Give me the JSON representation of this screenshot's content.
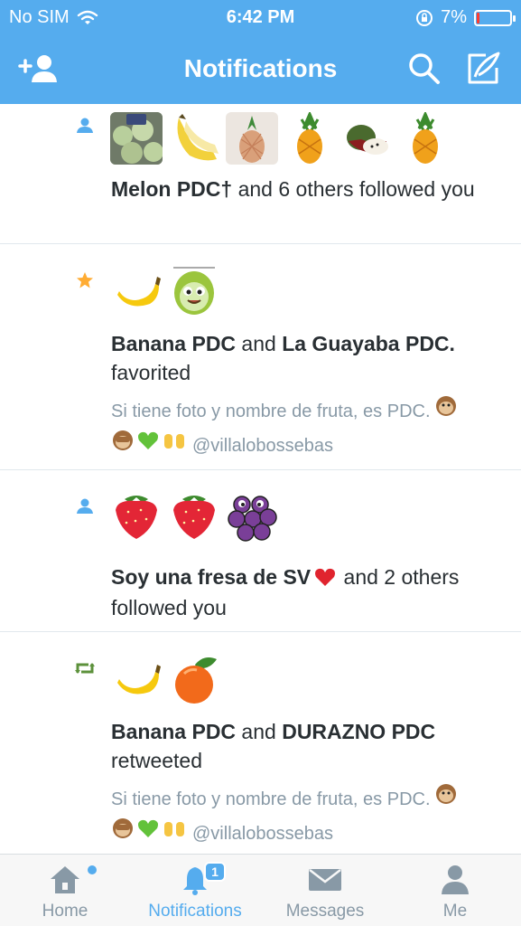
{
  "status": {
    "carrier": "No SIM",
    "time": "6:42 PM",
    "battery": "7%",
    "battery_level": 0.07
  },
  "nav": {
    "title": "Notifications"
  },
  "notifications": [
    {
      "type": "follow",
      "line_bold_1": "Melon PDC†",
      "line_rest": " and 6 others followed you"
    },
    {
      "type": "favorite",
      "line_bold_1": "Banana PDC",
      "line_and": " and ",
      "line_bold_2": "La Guayaba PDC.",
      "line_action": "favorited",
      "tweet_text": "Si tiene foto y nombre de fruta, es PDC.",
      "tweet_handle": "@villalobossebas"
    },
    {
      "type": "follow",
      "line_bold_1": "Soy una fresa de SV",
      "line_rest_a": " and 2 others",
      "line_rest_b": "followed you"
    },
    {
      "type": "retweet",
      "line_bold_1": "Banana PDC",
      "line_and": " and ",
      "line_bold_2": "DURAZNO PDC",
      "line_action": "retweeted",
      "tweet_text": "Si tiene foto y nombre de fruta, es PDC.",
      "tweet_handle": "@villalobossebas"
    }
  ],
  "tabs": [
    {
      "label": "Home",
      "icon": "home-icon"
    },
    {
      "label": "Notifications",
      "icon": "bell-icon",
      "badge": "1"
    },
    {
      "label": "Messages",
      "icon": "envelope-icon"
    },
    {
      "label": "Me",
      "icon": "person-icon"
    }
  ],
  "colors": {
    "brand": "#55acee",
    "favorite": "#ffac33",
    "retweet": "#5c913b",
    "muted": "#8899a6"
  }
}
